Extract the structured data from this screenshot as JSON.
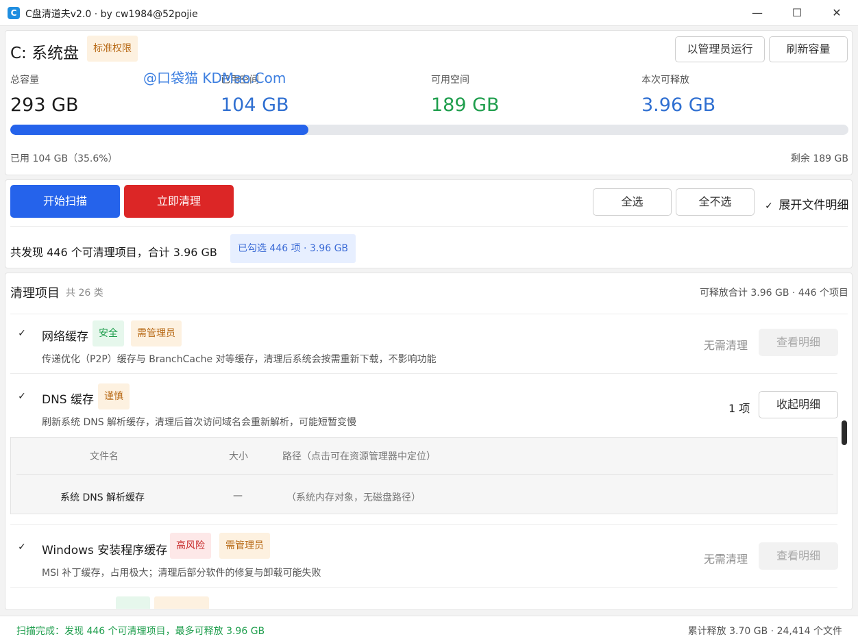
{
  "window": {
    "title": "C盘清道夫v2.0 · by cw1984@52pojie",
    "icon_letter": "C",
    "min": "—",
    "max": "☐",
    "close": "✕"
  },
  "disk": {
    "title": "C: 系统盘",
    "permission_badge": "标准权限",
    "run_as_admin": "以管理员运行",
    "refresh": "刷新容量",
    "watermark": "@口袋猫 KDMao.Com",
    "stats": [
      {
        "label": "总容量",
        "value": "293 GB",
        "color": "#1b1b1b"
      },
      {
        "label": "已用空间",
        "value": "104 GB",
        "color": "#2f6fd1"
      },
      {
        "label": "可用空间",
        "value": "189 GB",
        "color": "#1f9e4d"
      },
      {
        "label": "本次可释放",
        "value": "3.96 GB",
        "color": "#2f6fd1"
      }
    ],
    "used_fraction": 0.356,
    "used_text": "已用 104 GB（35.6%）",
    "free_text": "剩余 189 GB"
  },
  "actions": {
    "scan": "开始扫描",
    "clean": "立即清理",
    "select_all": "全选",
    "select_none": "全不选",
    "expand_check": "✓",
    "expand_label": "展开文件明细",
    "summary": "共发现 446 个可清理项目，合计 3.96 GB",
    "selected": "已勾选 446 项 · 3.96 GB"
  },
  "list": {
    "title": "清理项目",
    "count": "共 26 类",
    "total": "可释放合计 3.96 GB · 446 个项目",
    "items": [
      {
        "check": "✓",
        "title": "网络缓存",
        "tags": [
          "安全",
          "需管理员"
        ],
        "desc": "传递优化（P2P）缓存与 BranchCache 对等缓存，清理后系统会按需重新下载，不影响功能",
        "status": "无需清理",
        "button": "查看明细"
      },
      {
        "check": "✓",
        "title": "DNS 缓存",
        "tags": [
          "谨慎"
        ],
        "desc": "刷新系统 DNS 解析缓存，清理后首次访问域名会重新解析，可能短暂变慢",
        "status": "1 项",
        "button": "收起明细"
      },
      {
        "check": "✓",
        "title": "Windows 安装程序缓存",
        "tags": [
          "高风险",
          "需管理员"
        ],
        "desc": "MSI 补丁缓存，占用极大；清理后部分软件的修复与卸载可能失败",
        "status": "无需清理",
        "button": "查看明细"
      }
    ],
    "detail": {
      "headers": [
        "文件名",
        "大小",
        "路径（点击可在资源管理器中定位）"
      ],
      "row": [
        "系统 DNS 解析缓存",
        "—",
        "（系统内存对象，无磁盘路径）"
      ]
    }
  },
  "status": {
    "left": "扫描完成：发现 446 个可清理项目，最多可释放 3.96 GB",
    "right": "累计释放 3.70 GB · 24,414 个文件"
  }
}
